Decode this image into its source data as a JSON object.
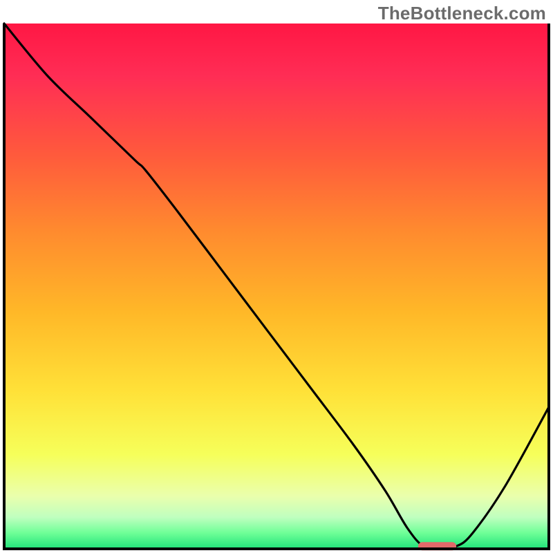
{
  "watermark": {
    "text": "TheBottleneck.com"
  },
  "colors": {
    "gradient_stops": [
      {
        "offset": 0.0,
        "color": "#ff1744"
      },
      {
        "offset": 0.1,
        "color": "#ff2d55"
      },
      {
        "offset": 0.25,
        "color": "#ff5a3c"
      },
      {
        "offset": 0.4,
        "color": "#ff8c2e"
      },
      {
        "offset": 0.55,
        "color": "#ffb828"
      },
      {
        "offset": 0.7,
        "color": "#ffe138"
      },
      {
        "offset": 0.82,
        "color": "#f6ff5a"
      },
      {
        "offset": 0.9,
        "color": "#eaffad"
      },
      {
        "offset": 0.94,
        "color": "#bfffbf"
      },
      {
        "offset": 0.97,
        "color": "#6eff97"
      },
      {
        "offset": 1.0,
        "color": "#20e27a"
      }
    ],
    "curve": "#000000",
    "marker_fill": "#e26a6a",
    "marker_stroke": "#e26a6a",
    "frame": "#000000"
  },
  "chart_data": {
    "type": "line",
    "title": "",
    "xlabel": "",
    "ylabel": "",
    "xlim": [
      0,
      100
    ],
    "ylim": [
      0,
      100
    ],
    "note": "Single unlabeled curve over a heat gradient. y-values represent bottleneck percentage (higher = worse). Values estimated from pixel positions.",
    "x": [
      0,
      8,
      16,
      24,
      26,
      32,
      40,
      48,
      56,
      64,
      70,
      74,
      77,
      80,
      83,
      86,
      92,
      100
    ],
    "y": [
      100,
      90,
      82,
      74,
      72,
      64,
      53,
      42,
      31,
      20,
      11,
      4,
      0.5,
      0.5,
      0.5,
      3,
      12,
      27
    ],
    "marker": {
      "x_start": 76,
      "x_end": 83,
      "y": 0.5
    }
  }
}
